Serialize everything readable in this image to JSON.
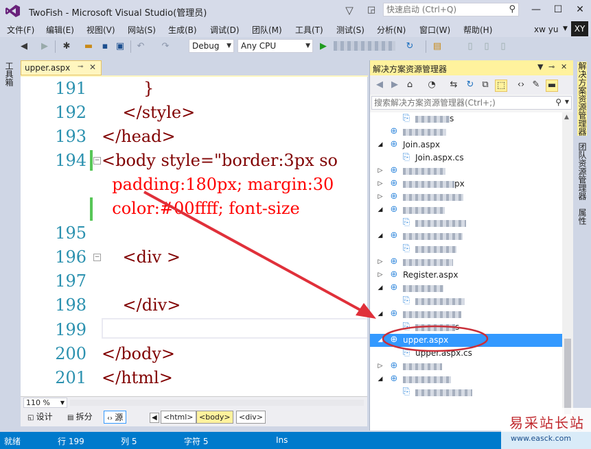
{
  "app": {
    "title": "TwoFish - Microsoft Visual Studio(管理员)",
    "quick_launch_placeholder": "快速启动 (Ctrl+Q)",
    "user_name": "xw yu",
    "user_initials": "XY"
  },
  "menu": [
    "文件(F)",
    "编辑(E)",
    "视图(V)",
    "网站(S)",
    "生成(B)",
    "调试(D)",
    "团队(M)",
    "工具(T)",
    "测试(S)",
    "分析(N)",
    "窗口(W)",
    "帮助(H)"
  ],
  "toolbar": {
    "configuration": "Debug",
    "platform": "Any CPU"
  },
  "left_strip": {
    "toolbox": "工具箱"
  },
  "editor": {
    "tab_label": "upper.aspx",
    "lines": [
      {
        "num": "191",
        "text": "        }"
      },
      {
        "num": "192",
        "text": "    </style>"
      },
      {
        "num": "193",
        "text": "</head>"
      },
      {
        "num": "194",
        "text": "<body style=\"border:3px so"
      },
      {
        "num": "",
        "text": "  padding:180px; margin:30"
      },
      {
        "num": "",
        "text": "  color:#00ffff; font-size"
      },
      {
        "num": "195",
        "text": ""
      },
      {
        "num": "196",
        "text": "    <div >"
      },
      {
        "num": "197",
        "text": ""
      },
      {
        "num": "198",
        "text": "    </div>"
      },
      {
        "num": "199",
        "text": ""
      },
      {
        "num": "200",
        "text": "</body>"
      },
      {
        "num": "201",
        "text": "</html>"
      }
    ],
    "zoom": "110 %"
  },
  "view_bar": {
    "design": "设计",
    "split": "拆分",
    "source": "源",
    "crumbs": [
      "<html>",
      "<body>",
      "<div>"
    ]
  },
  "solution_explorer": {
    "title": "解决方案资源管理器",
    "search_placeholder": "搜索解决方案资源管理器(Ctrl+;)",
    "items": [
      {
        "label": "s",
        "depth": 2,
        "expander": "",
        "blurred_prefix": true
      },
      {
        "label": "",
        "depth": 1,
        "expander": "",
        "blurred_prefix": true
      },
      {
        "label": "Join.aspx",
        "depth": 1,
        "expander": "◢"
      },
      {
        "label": "Join.aspx.cs",
        "depth": 2,
        "expander": ""
      },
      {
        "label": "",
        "depth": 1,
        "expander": "▷",
        "blurred_prefix": true
      },
      {
        "label": "px",
        "depth": 1,
        "expander": "▷",
        "blurred_prefix": true
      },
      {
        "label": "",
        "depth": 1,
        "expander": "▷",
        "blurred_prefix": true
      },
      {
        "label": "",
        "depth": 1,
        "expander": "◢",
        "blurred_prefix": true
      },
      {
        "label": "",
        "depth": 2,
        "expander": "",
        "blurred_prefix": true
      },
      {
        "label": "",
        "depth": 1,
        "expander": "◢",
        "blurred_prefix": true
      },
      {
        "label": "",
        "depth": 2,
        "expander": "",
        "blurred_prefix": true
      },
      {
        "label": "",
        "depth": 1,
        "expander": "▷",
        "blurred_prefix": true
      },
      {
        "label": "Register.aspx",
        "depth": 1,
        "expander": "▷"
      },
      {
        "label": "",
        "depth": 1,
        "expander": "◢",
        "blurred_prefix": true
      },
      {
        "label": "",
        "depth": 2,
        "expander": "",
        "blurred_prefix": true
      },
      {
        "label": "",
        "depth": 1,
        "expander": "◢",
        "blurred_prefix": true
      },
      {
        "label": "s",
        "depth": 2,
        "expander": "",
        "blurred_prefix": true
      },
      {
        "label": "upper.aspx",
        "depth": 1,
        "expander": "◢",
        "selected": true
      },
      {
        "label": "upper.aspx.cs",
        "depth": 2,
        "expander": ""
      },
      {
        "label": "",
        "depth": 1,
        "expander": "▷",
        "blurred_prefix": true
      },
      {
        "label": "",
        "depth": 1,
        "expander": "◢",
        "blurred_prefix": true
      },
      {
        "label": "",
        "depth": 2,
        "expander": "",
        "blurred_prefix": true
      }
    ]
  },
  "right_strip": {
    "tabs": [
      "解决方案资源管理器",
      "团队资源管理器",
      "属性"
    ]
  },
  "status_bar": {
    "state": "就绪",
    "line": "行 199",
    "col": "列 5",
    "char": "字符 5",
    "mode": "Ins"
  },
  "watermark": {
    "title": "易采站长站",
    "url": "www.easck.com"
  },
  "colors": {
    "accent": "#007acc",
    "annotation": "#e0303a",
    "selection": "#3399ff"
  }
}
